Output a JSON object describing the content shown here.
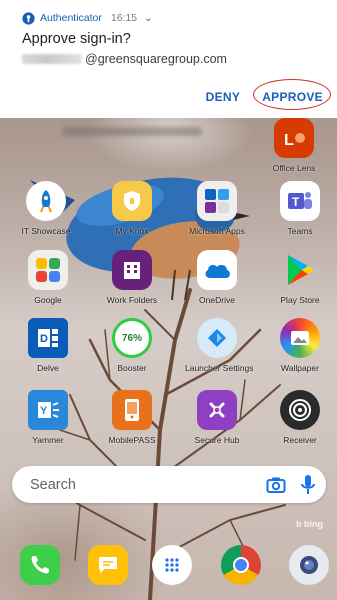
{
  "notification": {
    "app_name": "Authenticator",
    "time": "16:15",
    "title": "Approve sign-in?",
    "email_domain": "@greensquaregroup.com",
    "deny_label": "DENY",
    "approve_label": "APPROVE"
  },
  "apps": {
    "office_lens": "Office Lens",
    "it_showcase": "IT Showcase",
    "my_knox": "My Knox",
    "microsoft_apps": "Microsoft Apps",
    "teams": "Teams",
    "google": "Google",
    "work_folders": "Work Folders",
    "onedrive": "OneDrive",
    "play_store": "Play Store",
    "delve": "Delve",
    "booster": "Booster",
    "booster_percent": "76%",
    "launcher_settings": "Launcher Settings",
    "wallpaper": "Wallpaper",
    "yammer": "Yammer",
    "mobilepass": "MobilePASS",
    "secure_hub": "Secure Hub",
    "receiver": "Receiver"
  },
  "search": {
    "placeholder": "Search"
  },
  "bing": "b bing",
  "colors": {
    "accent": "#1a5fb4",
    "highlight_ring": "#d0312d"
  }
}
